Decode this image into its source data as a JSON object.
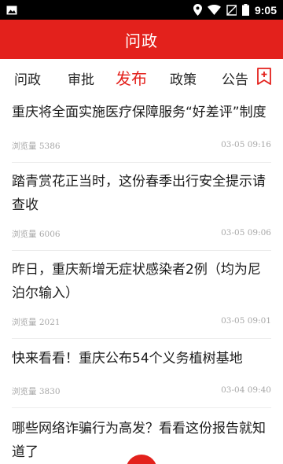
{
  "status": {
    "time": "9:05"
  },
  "header": {
    "title": "问政"
  },
  "tabs": [
    {
      "label": "问政"
    },
    {
      "label": "审批"
    },
    {
      "label": "发布"
    },
    {
      "label": "政策"
    },
    {
      "label": "公告"
    }
  ],
  "articles": [
    {
      "title": "重庆将全面实施医疗保障服务“好差评”制度",
      "views": "浏览量 5386",
      "date": "03-05 09:16"
    },
    {
      "title": "踏青赏花正当时，这份春季出行安全提示请查收",
      "views": "浏览量 6006",
      "date": "03-05 09:06"
    },
    {
      "title": "昨日，重庆新增无症状感染者2例（均为尼泊尔输入）",
      "views": "浏览量 2021",
      "date": "03-05 09:01"
    },
    {
      "title": "快来看看！重庆公布54个义务植树基地",
      "views": "浏览量 3830",
      "date": "03-04 09:40"
    },
    {
      "title": "哪些网络诈骗行为高发？看看这份报告就知道了",
      "views": "",
      "date": ""
    }
  ],
  "colors": {
    "brand": "#e3211c",
    "meta": "#a7a7a7"
  },
  "icons": {
    "status_left": "image-icon",
    "location": "location-icon",
    "wifi": "wifi-icon",
    "no_sim": "no-sim-icon",
    "battery": "battery-icon",
    "tab_add": "add-tab-icon"
  }
}
